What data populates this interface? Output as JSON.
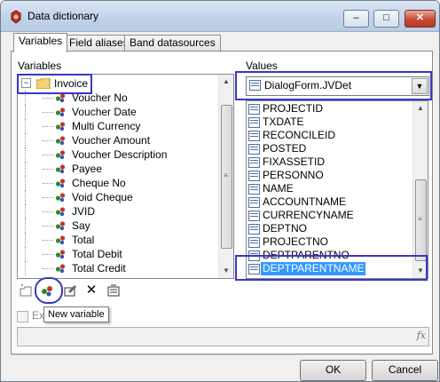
{
  "window": {
    "title": "Data dictionary",
    "close_label": "✕",
    "max_label": "□",
    "min_label": "–"
  },
  "tabs": [
    {
      "label": "Variables",
      "active": true
    },
    {
      "label": "Field aliases",
      "active": false
    },
    {
      "label": "Band datasources",
      "active": false
    }
  ],
  "variables": {
    "heading": "Variables",
    "root": {
      "label": "Invoice",
      "expander": "−"
    },
    "items": [
      "Voucher No",
      "Voucher Date",
      "Multi Currency",
      "Voucher Amount",
      "Voucher Description",
      "Payee",
      "Cheque No",
      "Void Cheque",
      "JVID",
      "Say",
      "Total",
      "Total Debit",
      "Total Credit"
    ]
  },
  "values": {
    "heading": "Values",
    "selected_source": "DialogForm.JVDet",
    "items": [
      "PROJECTID",
      "TXDATE",
      "RECONCILEID",
      "POSTED",
      "FIXASSETID",
      "PERSONNO",
      "NAME",
      "ACCOUNTNAME",
      "CURRENCYNAME",
      "DEPTNO",
      "PROJECTNO",
      "DEPTPARENTNO",
      "DEPTPARENTNAME"
    ],
    "selected_item": "DEPTPARENTNAME"
  },
  "toolbar": {
    "tooltip": "New variable"
  },
  "expression": {
    "checkbox_label": "Ex",
    "fx_label": "fx"
  },
  "buttons": {
    "ok": "OK",
    "cancel": "Cancel"
  },
  "colors": {
    "highlight": "#3a37c4",
    "selection": "#3399ff"
  }
}
